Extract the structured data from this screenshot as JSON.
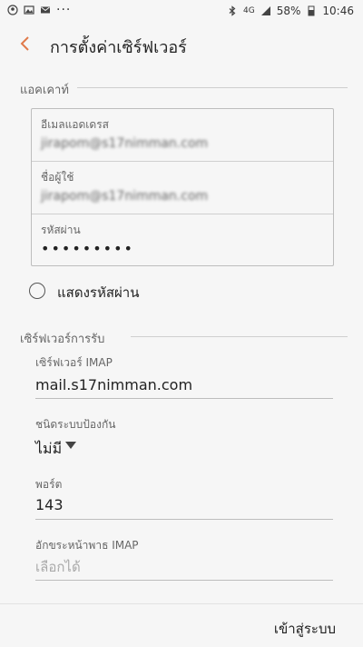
{
  "status_bar": {
    "network": "4G",
    "battery": "58%",
    "time": "10:46",
    "more_icon": "more-dots-icon"
  },
  "header": {
    "back_icon": "back-arrow-icon",
    "title": "การตั้งค่าเซิร์ฟเวอร์"
  },
  "account_section": {
    "title": "แอคเคาท์",
    "email_label": "อีเมลแอดเดรส",
    "email_value": "jirapom@s17nimman.com",
    "username_label": "ชื่อผู้ใช้",
    "username_value": "jirapom@s17nimman.com",
    "password_label": "รหัสผ่าน",
    "password_value": "•••••••••",
    "show_password_label": "แสดงรหัสผ่าน"
  },
  "incoming_section": {
    "title": "เซิร์ฟเวอร์การรับ",
    "server_label": "เซิร์ฟเวอร์ IMAP",
    "server_value": "mail.s17nimman.com",
    "security_label": "ชนิดระบบป้องกัน",
    "security_value": "ไม่มี",
    "port_label": "พอร์ต",
    "port_value": "143",
    "prefix_label": "อักขระหน้าพาธ IMAP",
    "prefix_placeholder": "เลือกได้"
  },
  "footer": {
    "signin_label": "เข้าสู่ระบบ"
  },
  "colors": {
    "accent": "#e07a4a",
    "background": "#f6f6f6"
  }
}
